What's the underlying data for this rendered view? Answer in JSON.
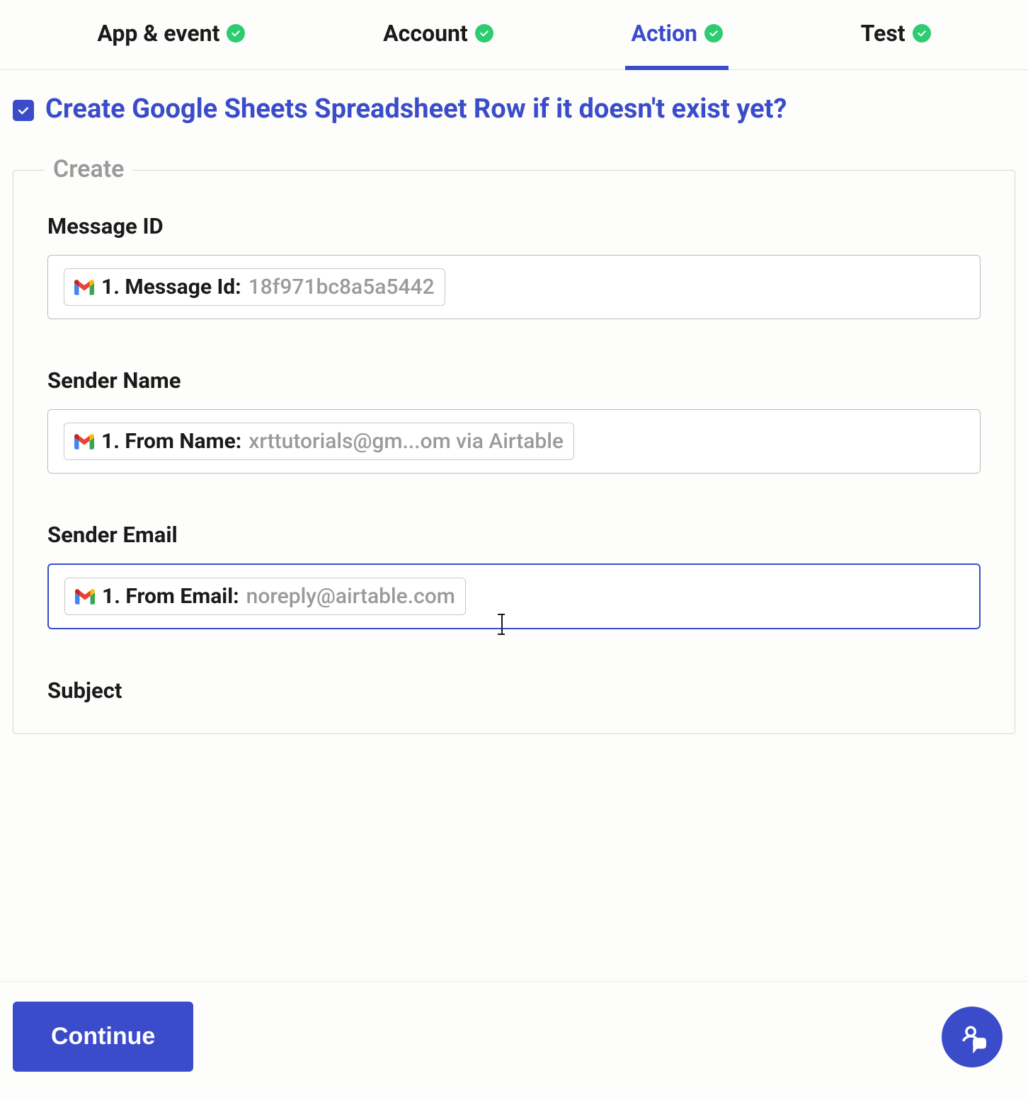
{
  "tabs": {
    "app_event": "App & event",
    "account": "Account",
    "action": "Action",
    "test": "Test",
    "active": "action"
  },
  "option": {
    "checked": true,
    "label": "Create Google Sheets Spreadsheet Row if it doesn't exist yet?"
  },
  "fieldset": {
    "legend": "Create",
    "fields": [
      {
        "label": "Message ID",
        "pill_prefix": "1. Message Id:",
        "pill_value": "18f971bc8a5a5442"
      },
      {
        "label": "Sender Name",
        "pill_prefix": "1. From Name:",
        "pill_value": "xrttutorials@gm...om via Airtable"
      },
      {
        "label": "Sender Email",
        "pill_prefix": "1. From Email:",
        "pill_value": "noreply@airtable.com"
      },
      {
        "label": "Subject",
        "pill_prefix": "",
        "pill_value": ""
      }
    ]
  },
  "footer": {
    "continue": "Continue"
  },
  "colors": {
    "accent": "#3b4cca",
    "success": "#2ecc71",
    "muted": "#9a9a9a"
  }
}
